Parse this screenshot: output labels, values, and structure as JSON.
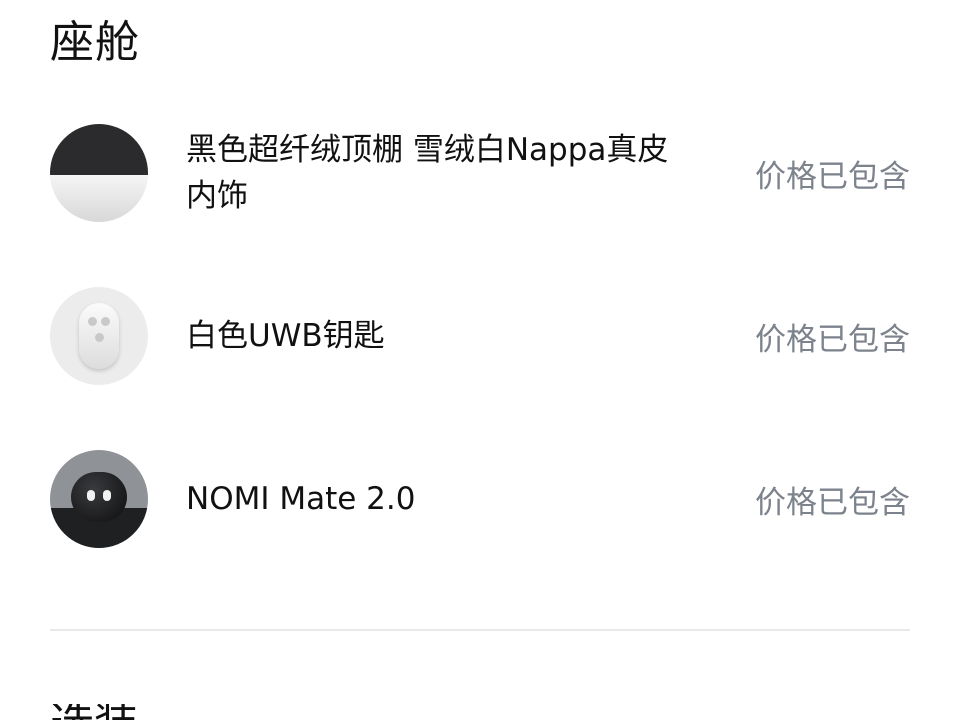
{
  "section": {
    "title": "座舱"
  },
  "items": [
    {
      "name": "黑色超纤绒顶棚 雪绒白Nappa真皮内饰",
      "price_status": "价格已包含"
    },
    {
      "name": "白色UWB钥匙",
      "price_status": "价格已包含"
    },
    {
      "name": "NOMI Mate 2.0",
      "price_status": "价格已包含"
    }
  ],
  "next_section": {
    "title": "选装"
  }
}
